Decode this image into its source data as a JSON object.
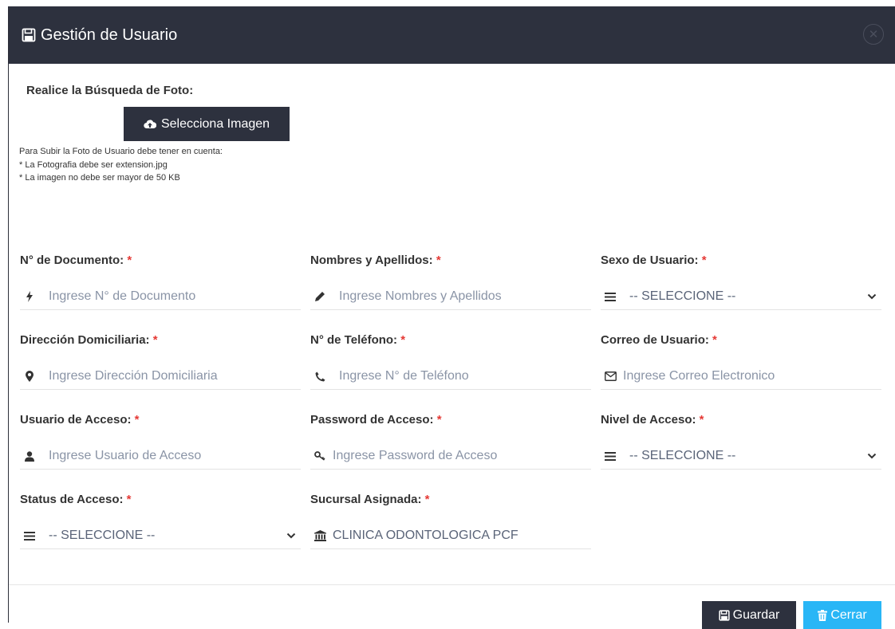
{
  "header": {
    "title": "Gestión de Usuario"
  },
  "photo": {
    "title": "Realice la Búsqueda de Foto:",
    "button_label": "Selecciona Imagen",
    "notes": [
      "Para Subir la Foto de Usuario debe tener en cuenta:",
      "* La Fotografia debe ser extension.jpg",
      "* La imagen no debe ser mayor de 50 KB"
    ]
  },
  "fields": {
    "documento": {
      "label": "N° de Documento:",
      "placeholder": "Ingrese N° de Documento",
      "icon": "bolt-icon"
    },
    "nombres": {
      "label": "Nombres y Apellidos:",
      "placeholder": "Ingrese Nombres y Apellidos",
      "icon": "pencil-icon"
    },
    "sexo": {
      "label": "Sexo de Usuario:",
      "selected": "-- SELECCIONE --",
      "icon": "list-icon"
    },
    "direccion": {
      "label": "Dirección Domiciliaria:",
      "placeholder": "Ingrese Dirección Domiciliaria",
      "icon": "map-marker-icon"
    },
    "telefono": {
      "label": "N° de Teléfono:",
      "placeholder": "Ingrese N° de Teléfono",
      "icon": "phone-icon"
    },
    "correo": {
      "label": "Correo de Usuario:",
      "placeholder": "Ingrese Correo Electronico",
      "icon": "envelope-icon"
    },
    "usuario": {
      "label": "Usuario de Acceso:",
      "placeholder": "Ingrese Usuario de Acceso",
      "icon": "user-icon"
    },
    "password": {
      "label": "Password de Acceso:",
      "placeholder": "Ingrese Password de Acceso",
      "icon": "key-icon"
    },
    "nivel": {
      "label": "Nivel de Acceso:",
      "selected": "-- SELECCIONE --",
      "icon": "list-icon"
    },
    "status": {
      "label": "Status de Acceso:",
      "selected": "-- SELECCIONE --",
      "icon": "list-icon"
    },
    "sucursal": {
      "label": "Sucursal Asignada:",
      "value": "CLINICA ODONTOLOGICA PCF",
      "icon": "bank-icon"
    }
  },
  "required_mark": "*",
  "footer": {
    "save_label": "Guardar",
    "close_label": "Cerrar"
  },
  "colors": {
    "header_bg": "#2d313e",
    "close_btn": "#29b6f6",
    "required": "#e53935"
  }
}
